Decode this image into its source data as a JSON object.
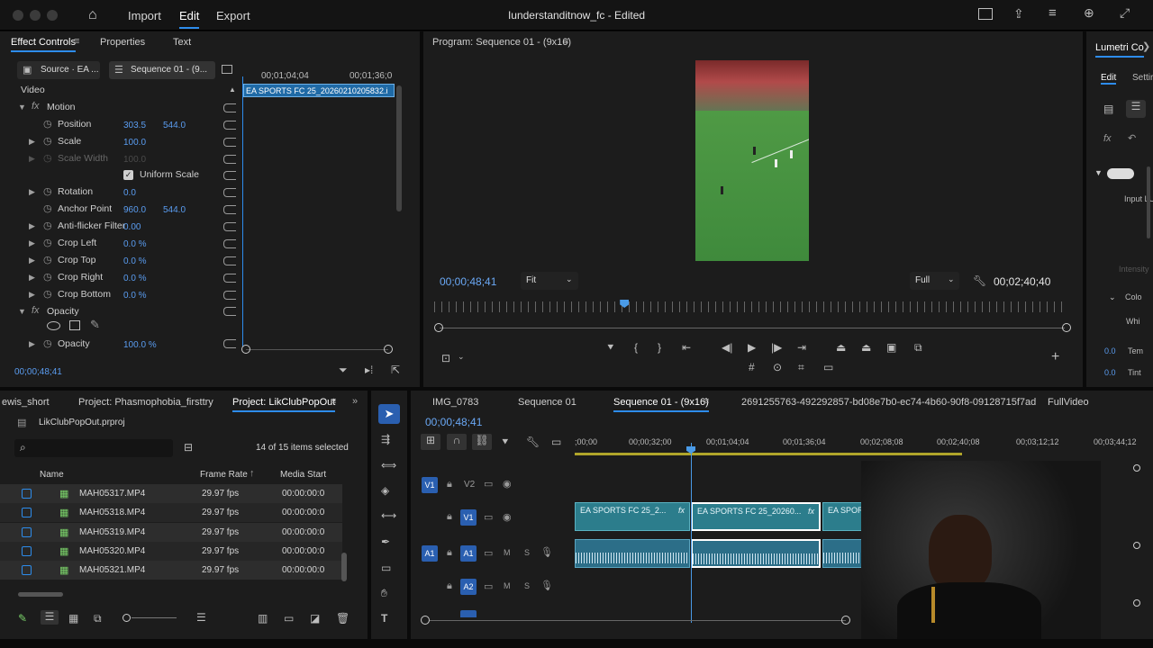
{
  "app": {
    "menu": [
      "Import",
      "Edit",
      "Export"
    ],
    "active_menu": "Edit",
    "title": "Iunderstanditnow_fc - Edited"
  },
  "effect_controls": {
    "tabs": [
      "Effect Controls",
      "Properties",
      "Text"
    ],
    "source_tab": "Source · EA ...",
    "sequence_tab": "Sequence 01 - (9...",
    "time_a": "00;01;04;04",
    "time_b": "00;01;36;0",
    "clip_name": "EA SPORTS FC 25_20260210205832.i",
    "video_label": "Video",
    "motion_label": "Motion",
    "props": {
      "position": {
        "label": "Position",
        "x": "303.5",
        "y": "544.0"
      },
      "scale": {
        "label": "Scale",
        "v": "100.0"
      },
      "scale_width": {
        "label": "Scale Width",
        "v": "100.0"
      },
      "uniform_scale": "Uniform Scale",
      "rotation": {
        "label": "Rotation",
        "v": "0.0"
      },
      "anchor": {
        "label": "Anchor Point",
        "x": "960.0",
        "y": "544.0"
      },
      "antiflicker": {
        "label": "Anti-flicker Filter",
        "v": "0.00"
      },
      "crop_left": {
        "label": "Crop Left",
        "v": "0.0 %"
      },
      "crop_top": {
        "label": "Crop Top",
        "v": "0.0 %"
      },
      "crop_right": {
        "label": "Crop Right",
        "v": "0.0 %"
      },
      "crop_bottom": {
        "label": "Crop Bottom",
        "v": "0.0 %"
      },
      "opacity_group": "Opacity",
      "opacity": {
        "label": "Opacity",
        "v": "100.0 %"
      }
    },
    "timecode": "00;00;48;41"
  },
  "program": {
    "title": "Program: Sequence 01 - (9x16)",
    "timecode": "00;00;48;41",
    "fit": "Fit",
    "quality": "Full",
    "duration": "00;02;40;40",
    "playhead_fraction": 0.3
  },
  "lumetri": {
    "title": "Lumetri Co",
    "tabs": [
      "Edit",
      "Settir"
    ],
    "input": "Input LU",
    "intensity": "Intensity",
    "color": "Colo",
    "white": "Whi",
    "temp": {
      "label": "Tem",
      "v": "0.0"
    },
    "tint": {
      "label": "Tint",
      "v": "0.0"
    }
  },
  "project": {
    "tabs": [
      "ewis_short",
      "Project: Phasmophobia_firsttry",
      "Project: LikClubPopOut"
    ],
    "file": "LikClubPopOut.prproj",
    "selected": "14 of 15 items selected",
    "columns": [
      "Name",
      "Frame Rate",
      "Media Start"
    ],
    "rows": [
      {
        "name": "MAH05317.MP4",
        "rate": "29.97 fps",
        "start": "00:00:00:0"
      },
      {
        "name": "MAH05318.MP4",
        "rate": "29.97 fps",
        "start": "00:00:00:0"
      },
      {
        "name": "MAH05319.MP4",
        "rate": "29.97 fps",
        "start": "00:00:00:0"
      },
      {
        "name": "MAH05320.MP4",
        "rate": "29.97 fps",
        "start": "00:00:00:0"
      },
      {
        "name": "MAH05321.MP4",
        "rate": "29.97 fps",
        "start": "00:00:00:0"
      }
    ]
  },
  "timeline": {
    "tabs": [
      "IMG_0783",
      "Sequence 01",
      "Sequence 01 - (9x16)",
      "2691255763-492292857-bd08e7b0-ec74-4b60-90f8-09128715f7ad",
      "FullVideo"
    ],
    "active_tab": "Sequence 01 - (9x16)",
    "timecode": "00;00;48;41",
    "ruler": [
      ";00;00",
      "00;00;32;00",
      "00;01;04;04",
      "00;01;36;04",
      "00;02;08;08",
      "00;02;40;08",
      "00;03;12;12",
      "00;03;44;12"
    ],
    "tracks": {
      "v2": "V2",
      "v1": "V1",
      "a1": "A1",
      "a2": "A2",
      "m": "M",
      "s": "S"
    },
    "clips": [
      "EA SPORTS FC 25_2...",
      "EA SPORTS FC 25_20260...",
      "EA SPOR"
    ],
    "fx": "fx"
  }
}
